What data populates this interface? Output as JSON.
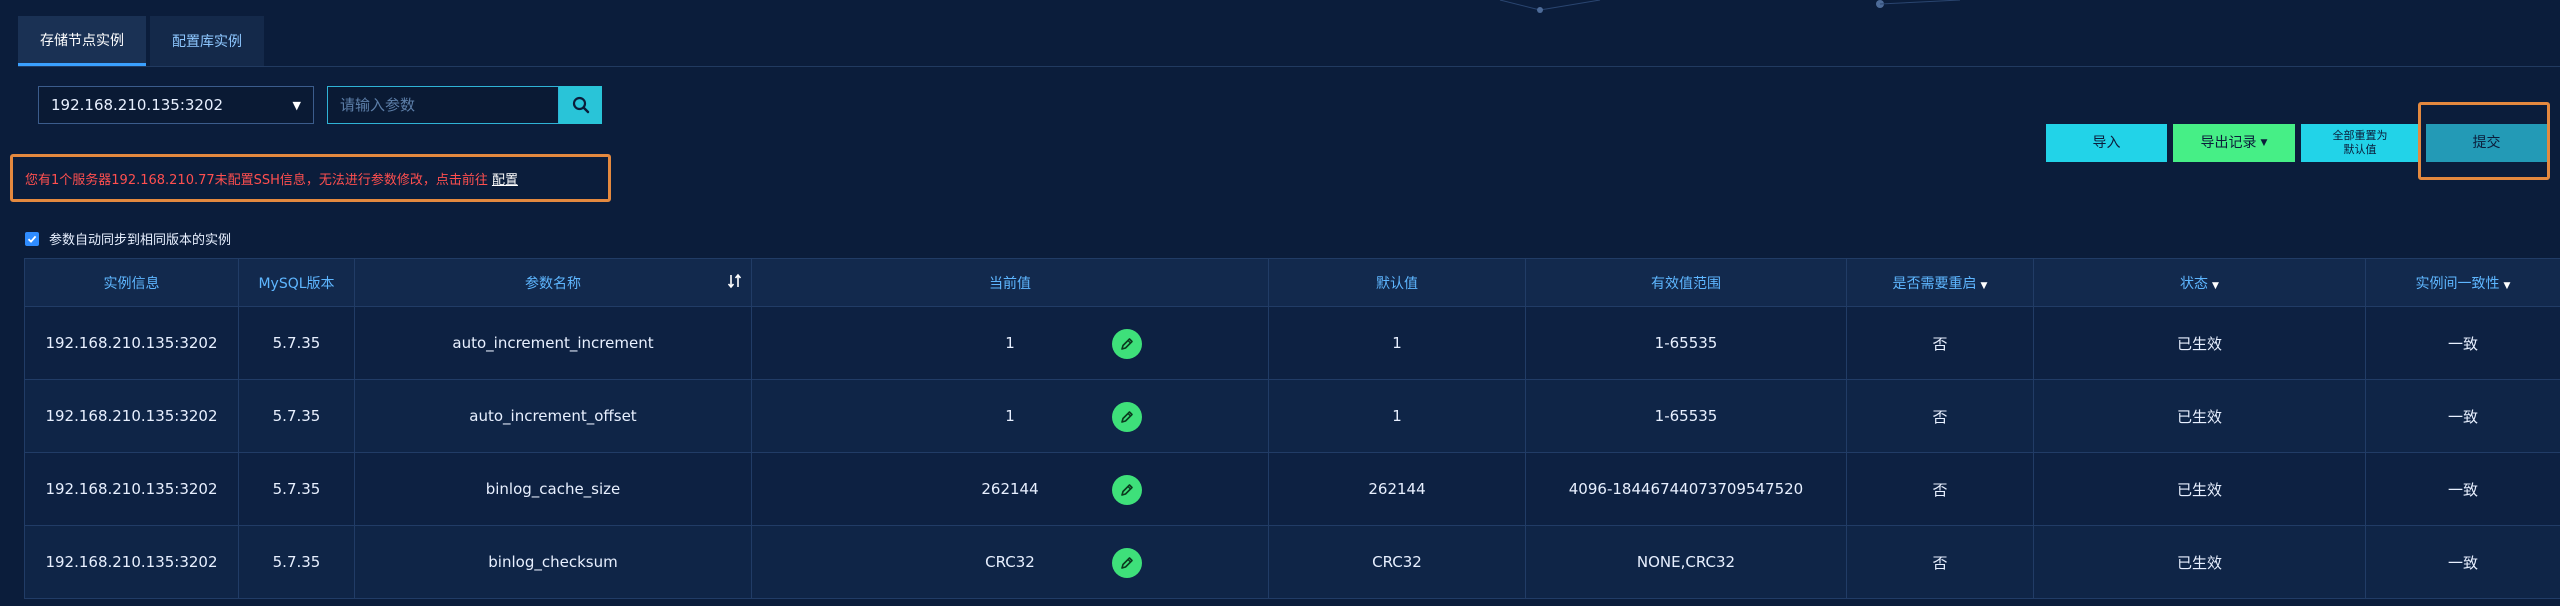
{
  "tabs": [
    {
      "label": "存储节点实例",
      "active": true
    },
    {
      "label": "配置库实例",
      "active": false
    }
  ],
  "instance_select": {
    "value": "192.168.210.135:3202"
  },
  "search": {
    "placeholder": "请输入参数"
  },
  "actions": {
    "import": "导入",
    "export": "导出记录",
    "reset_line1": "全部重置为",
    "reset_line2": "默认值",
    "submit": "提交"
  },
  "warning": {
    "text": "您有1个服务器192.168.210.77未配置SSH信息，无法进行参数修改，点击前往",
    "link": "配置"
  },
  "sync": {
    "label": "参数自动同步到相同版本的实例",
    "checked": true
  },
  "table": {
    "headers": {
      "instance": "实例信息",
      "mysql_version": "MySQL版本",
      "param_name": "参数名称",
      "current_value": "当前值",
      "default_value": "默认值",
      "valid_range": "有效值范围",
      "need_restart": "是否需要重启",
      "status": "状态",
      "consistency": "实例间一致性"
    },
    "rows": [
      {
        "instance": "192.168.210.135:3202",
        "version": "5.7.35",
        "name": "auto_increment_increment",
        "current": "1",
        "default": "1",
        "range": "1-65535",
        "restart": "否",
        "status": "已生效",
        "consistency": "一致"
      },
      {
        "instance": "192.168.210.135:3202",
        "version": "5.7.35",
        "name": "auto_increment_offset",
        "current": "1",
        "default": "1",
        "range": "1-65535",
        "restart": "否",
        "status": "已生效",
        "consistency": "一致"
      },
      {
        "instance": "192.168.210.135:3202",
        "version": "5.7.35",
        "name": "binlog_cache_size",
        "current": "262144",
        "default": "262144",
        "range": "4096-18446744073709547520",
        "restart": "否",
        "status": "已生效",
        "consistency": "一致"
      },
      {
        "instance": "192.168.210.135:3202",
        "version": "5.7.35",
        "name": "binlog_checksum",
        "current": "CRC32",
        "default": "CRC32",
        "range": "NONE,CRC32",
        "restart": "否",
        "status": "已生效",
        "consistency": "一致"
      }
    ]
  },
  "colors": {
    "accent": "#22d3e8",
    "green": "#46ef86",
    "warning": "#ff4f4f",
    "highlight_frame": "#e4893f"
  }
}
